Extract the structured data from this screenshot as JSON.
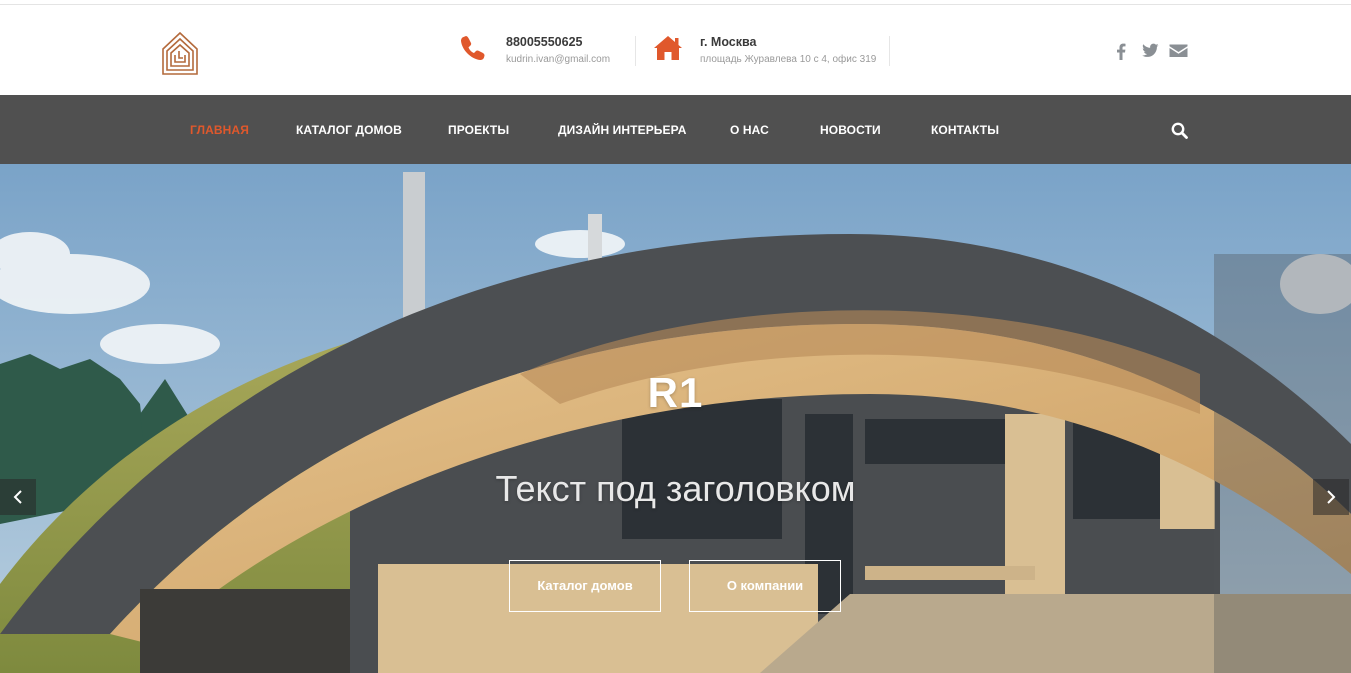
{
  "header": {
    "logo": {
      "icon": "house-logo-icon",
      "color": "#b46a3c"
    },
    "phone": {
      "icon": "phone-icon",
      "number": "88005550625",
      "email": "kudrin.ivan@gmail.com"
    },
    "address": {
      "icon": "home-icon",
      "city": "г. Москва",
      "street": "площадь Журавлева 10 с 4, офис 319"
    },
    "social": [
      {
        "icon": "facebook-icon"
      },
      {
        "icon": "twitter-icon"
      },
      {
        "icon": "envelope-icon"
      }
    ],
    "accent_color": "#e0582c"
  },
  "nav": {
    "items": [
      {
        "label": "ГЛАВНАЯ",
        "active": true
      },
      {
        "label": "КАТАЛОГ ДОМОВ",
        "active": false
      },
      {
        "label": "ПРОЕКТЫ",
        "active": false
      },
      {
        "label": "ДИЗАЙН ИНТЕРЬЕРА",
        "active": false
      },
      {
        "label": "О НАС",
        "active": false
      },
      {
        "label": "НОВОСТИ",
        "active": false
      },
      {
        "label": "КОНТАКТЫ",
        "active": false
      }
    ],
    "search_icon": "search-icon",
    "background": "#505050"
  },
  "hero": {
    "title": "R1",
    "subtitle": "Текст под заголовком",
    "buttons": [
      {
        "label": "Каталог домов"
      },
      {
        "label": "О компании"
      }
    ],
    "prev_icon": "chevron-left-icon",
    "next_icon": "chevron-right-icon"
  }
}
